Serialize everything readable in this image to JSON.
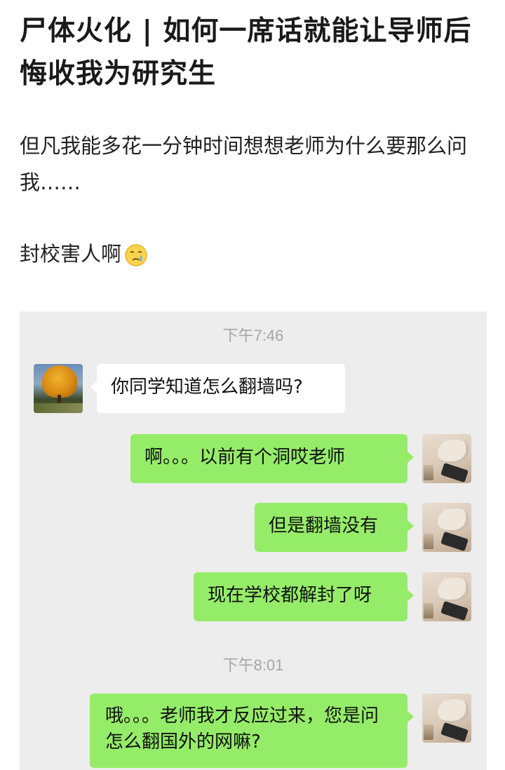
{
  "post": {
    "title": "尸体火化 | 如何一席话就能让导师后悔收我为研究生",
    "body": "但凡我能多花一分钟时间想想老师为什么要那么问我……",
    "line2": "封校害人啊",
    "line2_emoji": "crying-face-emoji"
  },
  "chat": {
    "timestamp1": "下午7:46",
    "timestamp2": "下午8:01",
    "messages": [
      {
        "side": "left",
        "text": "你同学知道怎么翻墙吗?"
      },
      {
        "side": "right",
        "text": "啊。。。以前有个洞哎老师"
      },
      {
        "side": "right",
        "text": "但是翻墙没有"
      },
      {
        "side": "right",
        "text": "现在学校都解封了呀"
      },
      {
        "side": "right",
        "text": "哦。。。老师我才反应过来，您是问怎么翻国外的网嘛?"
      }
    ]
  },
  "colors": {
    "chat_background": "#ededed",
    "outgoing_bubble": "#95ec69",
    "incoming_bubble": "#ffffff",
    "timestamp": "#a6a6a6"
  }
}
